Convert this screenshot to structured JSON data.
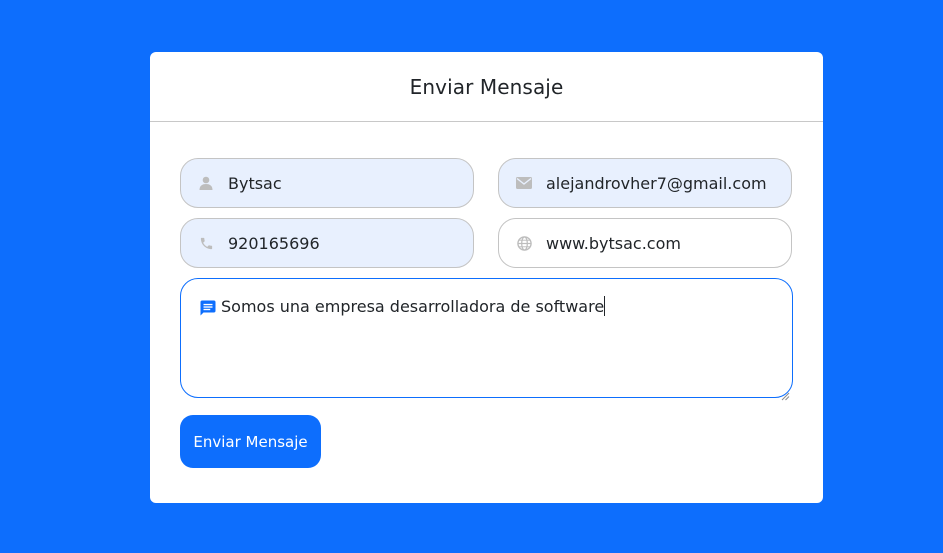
{
  "form": {
    "title": "Enviar Mensaje",
    "fields": {
      "name": {
        "value": "Bytsac",
        "icon": "user-icon"
      },
      "email": {
        "value": "alejandrovher7@gmail.com",
        "icon": "envelope-icon"
      },
      "phone": {
        "value": "920165696",
        "icon": "phone-icon"
      },
      "website": {
        "value": "www.bytsac.com",
        "icon": "globe-icon"
      }
    },
    "message": {
      "value": "Somos una empresa desarrolladora de software",
      "icon": "message-icon"
    },
    "submit_label": "Enviar Mensaje"
  },
  "colors": {
    "background": "#0d6efd",
    "card": "#ffffff",
    "autofill_field": "#e8f0fe",
    "accent": "#0d6efd",
    "icon_gray": "#bdbdbd"
  }
}
